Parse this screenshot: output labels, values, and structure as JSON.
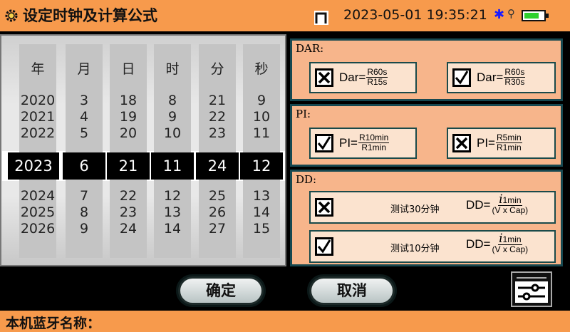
{
  "header": {
    "title": "设定时钟及计算公式",
    "datetime": "2023-05-01 19:35:21",
    "bluetooth_symbol": "✱",
    "usb_symbol": "⚲",
    "battery_color": "#2fd12f",
    "bar_color": "#f79a4c"
  },
  "picker": {
    "headers": [
      "年",
      "月",
      "日",
      "时",
      "分",
      "秒"
    ],
    "columns": [
      {
        "above": [
          "2020",
          "2021",
          "2022"
        ],
        "selected": "2023",
        "below": [
          "2024",
          "2025",
          "2026"
        ]
      },
      {
        "above": [
          "3",
          "4",
          "5"
        ],
        "selected": "6",
        "below": [
          "7",
          "8",
          "9"
        ]
      },
      {
        "above": [
          "18",
          "19",
          "20"
        ],
        "selected": "21",
        "below": [
          "22",
          "23",
          "24"
        ]
      },
      {
        "above": [
          "8",
          "9",
          "10"
        ],
        "selected": "11",
        "below": [
          "12",
          "13",
          "14"
        ]
      },
      {
        "above": [
          "21",
          "22",
          "23"
        ],
        "selected": "24",
        "below": [
          "25",
          "26",
          "27"
        ]
      },
      {
        "above": [
          "9",
          "10",
          "11"
        ],
        "selected": "12",
        "below": [
          "13",
          "14",
          "15"
        ]
      }
    ]
  },
  "dar": {
    "title": "DAR:",
    "options": [
      {
        "checked": false,
        "lhs": "Dar=",
        "num": "R60s",
        "den": "R15s"
      },
      {
        "checked": true,
        "lhs": "Dar=",
        "num": "R60s",
        "den": "R30s"
      }
    ]
  },
  "pi": {
    "title": "PI:",
    "options": [
      {
        "checked": true,
        "lhs": "PI=",
        "num": "R10min",
        "den": "R1min"
      },
      {
        "checked": false,
        "lhs": "PI=",
        "num": "R5min",
        "den": "R1min"
      }
    ]
  },
  "dd": {
    "title": "DD:",
    "options": [
      {
        "checked": false,
        "label": "测试30分钟",
        "lhs": "DD=",
        "num_italic": "i",
        "num": "1min",
        "den": "(V x Cap)"
      },
      {
        "checked": true,
        "label": "测试10分钟",
        "lhs": "DD=",
        "num_italic": "i",
        "num": "1min",
        "den": "(V x Cap)"
      }
    ]
  },
  "buttons": {
    "confirm": "确定",
    "cancel": "取消"
  },
  "footer": {
    "bluetooth_name_label": "本机蓝牙名称："
  }
}
